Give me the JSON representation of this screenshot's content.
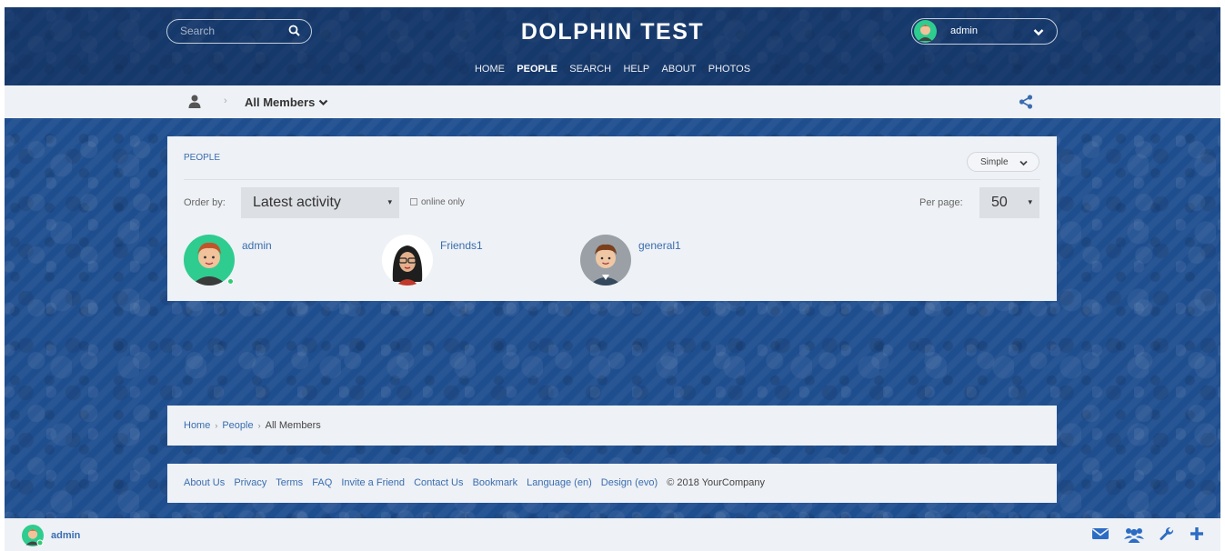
{
  "header": {
    "site_title": "DOLPHIN TEST",
    "search_placeholder": "Search",
    "username": "admin",
    "nav": [
      "HOME",
      "PEOPLE",
      "SEARCH",
      "HELP",
      "ABOUT",
      "PHOTOS"
    ],
    "active_nav": "PEOPLE"
  },
  "subbar": {
    "section": "All Members"
  },
  "panel": {
    "title": "PEOPLE",
    "view_mode": "Simple",
    "order_by_label": "Order by:",
    "order_by_value": "Latest activity",
    "online_only_label": "online only",
    "per_page_label": "Per page:",
    "per_page_value": "50",
    "members": [
      {
        "name": "admin",
        "online": true
      },
      {
        "name": "Friends1",
        "online": false
      },
      {
        "name": "general1",
        "online": false
      }
    ]
  },
  "breadcrumb": {
    "home": "Home",
    "people": "People",
    "current": "All Members"
  },
  "footer": {
    "links": [
      "About Us",
      "Privacy",
      "Terms",
      "FAQ",
      "Invite a Friend",
      "Contact Us",
      "Bookmark",
      "Language (en)",
      "Design (evo)"
    ],
    "copyright": "© 2018 YourCompany"
  },
  "bottombar": {
    "username": "admin"
  },
  "colors": {
    "accent": "#3a6db0",
    "background": "#1f4e8f",
    "panel": "#eef1f5",
    "online": "#2ecc71"
  }
}
